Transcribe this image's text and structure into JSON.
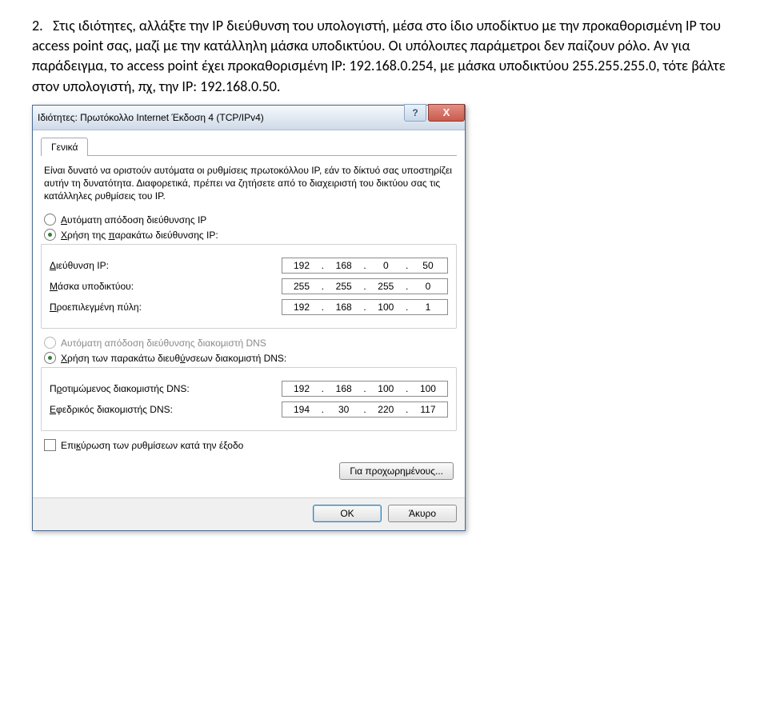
{
  "instructions": {
    "number": "2.",
    "text": "Στις ιδιότητες, αλλάξτε την IP διεύθυνση του υπολογιστή, μέσα στο ίδιο υποδίκτυο με την προκαθορισμένη IP του access point σας, μαζί με την κατάλληλη μάσκα υποδικτύου. Οι υπόλοιπες παράμετροι δεν παίζουν ρόλο. Αν για παράδειγμα, το access point έχει προκαθορισμένη IP: 192.168.0.254, με μάσκα υποδικτύου 255.255.255.0, τότε βάλτε στον υπολογιστή, πχ, την IP: 192.168.0.50."
  },
  "dialog": {
    "title": "Ιδιότητες: Πρωτόκολλο Internet Έκδοση 4 (TCP/IPv4)",
    "help_glyph": "?",
    "close_glyph": "X",
    "tab": "Γενικά",
    "desc": "Είναι δυνατό να οριστούν αυτόματα οι ρυθμίσεις πρωτοκόλλου IP, εάν το δίκτυό σας υποστηρίζει αυτήν τη δυνατότητα. Διαφορετικά, πρέπει να ζητήσετε από το διαχειριστή του δικτύου σας τις κατάλληλες ρυθμίσεις του IP.",
    "radio_auto_ip": "Αυτόματη απόδοση διεύθυνσης IP",
    "radio_use_ip": "Χρήση της παρακάτω διεύθυνσης IP:",
    "label_ip": "Διεύθυνση IP:",
    "label_mask": "Μάσκα υποδικτύου:",
    "label_gateway": "Προεπιλεγμένη πύλη:",
    "ip": {
      "a": "192",
      "b": "168",
      "c": "0",
      "d": "50"
    },
    "mask": {
      "a": "255",
      "b": "255",
      "c": "255",
      "d": "0"
    },
    "gateway": {
      "a": "192",
      "b": "168",
      "c": "100",
      "d": "1"
    },
    "radio_auto_dns": "Αυτόματη απόδοση διεύθυνσης διακομιστή DNS",
    "radio_use_dns": "Χρήση των παρακάτω διευθύνσεων διακομιστή DNS:",
    "label_dns1": "Προτιμώμενος διακομιστής DNS:",
    "label_dns2": "Εφεδρικός διακομιστής DNS:",
    "dns1": {
      "a": "192",
      "b": "168",
      "c": "100",
      "d": "100"
    },
    "dns2": {
      "a": "194",
      "b": "30",
      "c": "220",
      "d": "117"
    },
    "chk_validate": "Επικύρωση των ρυθμίσεων κατά την έξοδο",
    "btn_advanced": "Για προχωρημένους...",
    "btn_ok": "OK",
    "btn_cancel": "Άκυρο"
  }
}
